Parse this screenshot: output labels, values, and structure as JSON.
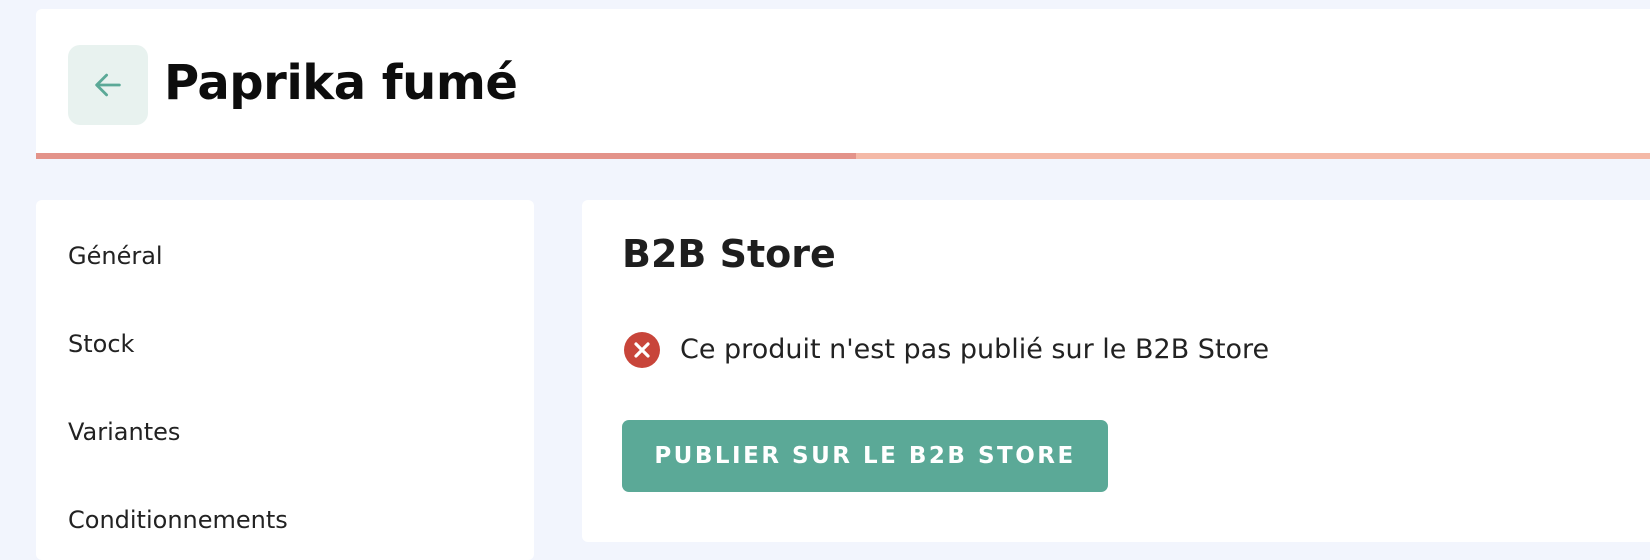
{
  "header": {
    "title": "Paprika fumé",
    "back_icon": "arrow-left-icon",
    "progress": 0.5,
    "colors": {
      "progress_done": "#e3938a",
      "progress_remaining": "#f4b9a7",
      "back_bg": "#e8f2ef",
      "back_icon": "#5ba997"
    }
  },
  "sidebar": {
    "items": [
      {
        "label": "Général"
      },
      {
        "label": "Stock"
      },
      {
        "label": "Variantes"
      },
      {
        "label": "Conditionnements"
      }
    ]
  },
  "main": {
    "section_title": "B2B Store",
    "status": {
      "icon": "error-x-circle-icon",
      "text": "Ce produit n'est pas publié sur le B2B Store",
      "color": "#c8453a"
    },
    "publish_button": {
      "label": "PUBLIER SUR LE B2B STORE",
      "color": "#5ba997"
    }
  }
}
